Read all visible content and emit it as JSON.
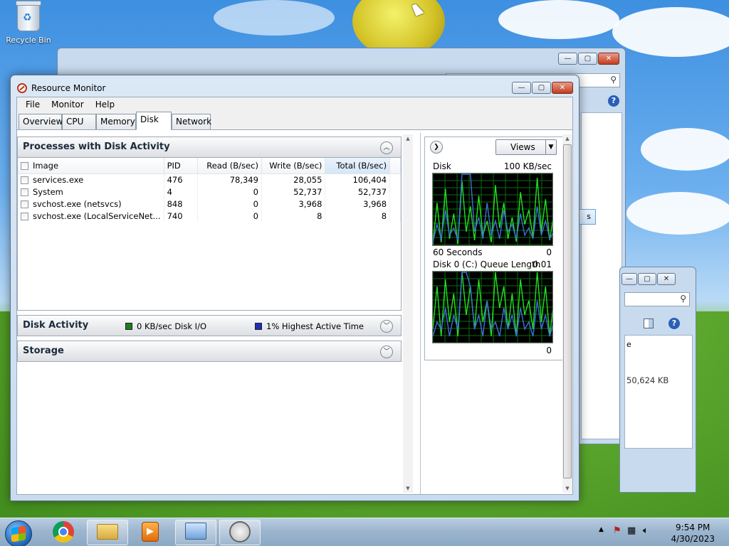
{
  "desktop": {
    "recycle_bin_label": "Recycle Bin"
  },
  "background_windows": {
    "partial_text_1": "s",
    "partial_text_2": "e",
    "partial_text_3": "50,624 KB"
  },
  "window": {
    "title": "Resource Monitor",
    "menu": [
      "File",
      "Monitor",
      "Help"
    ],
    "tabs": [
      "Overview",
      "CPU",
      "Memory",
      "Disk",
      "Network"
    ],
    "active_tab": "Disk"
  },
  "processes": {
    "title": "Processes with Disk Activity",
    "columns": {
      "image": "Image",
      "pid": "PID",
      "read": "Read (B/sec)",
      "write": "Write (B/sec)",
      "total": "Total (B/sec)"
    },
    "rows": [
      {
        "image": "services.exe",
        "pid": "476",
        "read": "78,349",
        "write": "28,055",
        "total": "106,404"
      },
      {
        "image": "System",
        "pid": "4",
        "read": "0",
        "write": "52,737",
        "total": "52,737"
      },
      {
        "image": "svchost.exe (netsvcs)",
        "pid": "848",
        "read": "0",
        "write": "3,968",
        "total": "3,968"
      },
      {
        "image": "svchost.exe (LocalServiceNet...",
        "pid": "740",
        "read": "0",
        "write": "8",
        "total": "8"
      }
    ]
  },
  "disk_activity": {
    "title": "Disk Activity",
    "io_label": "0 KB/sec Disk I/O",
    "active_time_label": "1% Highest Active Time",
    "io_color": "#1e7d1e",
    "active_color": "#1f2fb8"
  },
  "storage": {
    "title": "Storage"
  },
  "right_panel": {
    "views_label": "Views",
    "disk_graph": {
      "title": "Disk",
      "max_label": "100 KB/sec",
      "time_label": "60 Seconds",
      "min_label": "0"
    },
    "queue_graph": {
      "title": "Disk 0 (C:) Queue Length",
      "max_label": "0.01",
      "min_label": "0"
    }
  },
  "taskbar": {
    "time": "9:54 PM",
    "date": "4/30/2023"
  },
  "chart_data": [
    {
      "type": "line",
      "title": "Disk",
      "ylim": [
        0,
        100
      ],
      "series": [
        {
          "values": [
            2,
            60,
            5,
            80,
            10,
            45,
            3,
            90,
            20,
            55,
            8,
            70,
            15,
            35,
            5,
            85,
            25,
            60,
            10,
            40,
            6,
            75,
            30,
            50,
            12,
            95,
            20,
            65,
            8,
            45
          ]
        },
        {
          "values": [
            5,
            30,
            10,
            50,
            15,
            25,
            8,
            100,
            100,
            100,
            20,
            40,
            10,
            60,
            15,
            35,
            10,
            50,
            20,
            30,
            10,
            45,
            15,
            25,
            10,
            55,
            15,
            35,
            10,
            20
          ]
        }
      ]
    },
    {
      "type": "line",
      "title": "Disk 0 (C:) Queue Length",
      "ylim": [
        0,
        0.01
      ],
      "series": [
        {
          "values": [
            0.002,
            0.008,
            0.001,
            0.009,
            0.003,
            0.007,
            0.001,
            0.01,
            0.004,
            0.008,
            0.002,
            0.009,
            0.003,
            0.006,
            0.001,
            0.01,
            0.005,
            0.008,
            0.002,
            0.007,
            0.001,
            0.009,
            0.004,
            0.006,
            0.002,
            0.01,
            0.003,
            0.008,
            0.001,
            0.006
          ]
        },
        {
          "values": [
            0.001,
            0.003,
            0.002,
            0.005,
            0.001,
            0.004,
            0.002,
            0.01,
            0.01,
            0.008,
            0.002,
            0.004,
            0.001,
            0.006,
            0.002,
            0.003,
            0.001,
            0.005,
            0.002,
            0.004,
            0.001,
            0.005,
            0.002,
            0.003,
            0.001,
            0.006,
            0.002,
            0.004,
            0.001,
            0.003
          ]
        }
      ]
    }
  ]
}
